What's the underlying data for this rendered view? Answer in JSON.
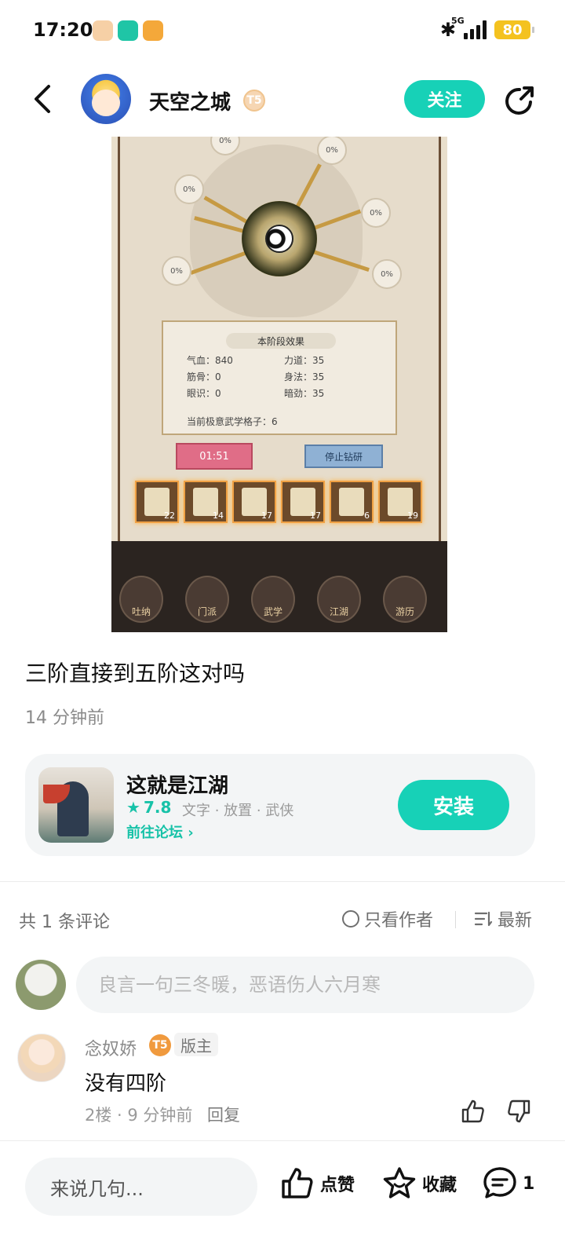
{
  "status_bar": {
    "time": "17:20",
    "network": "5G",
    "battery": "80",
    "bluetooth_icon": "bluetooth-icon"
  },
  "header": {
    "author_name": "天空之城",
    "author_level": "T5",
    "follow_label": "关注"
  },
  "post_image": {
    "nodes": [
      "0%",
      "0%",
      "0%",
      "0%",
      "0%",
      "0%"
    ],
    "panel_title": "本阶段效果",
    "stats": [
      {
        "label": "气血：840"
      },
      {
        "label": "力道：35"
      },
      {
        "label": "筋骨：0"
      },
      {
        "label": "身法：35"
      },
      {
        "label": "眼识：0"
      },
      {
        "label": "暗劲：35"
      }
    ],
    "current_slots": "当前极意武学格子：6",
    "timer": "01:51",
    "stop_label": "停止钻研",
    "slot_counts": [
      "22",
      "14",
      "17",
      "17",
      "6",
      "19"
    ],
    "tabs": [
      "吐纳",
      "门派",
      "武学",
      "江湖",
      "游历"
    ]
  },
  "post": {
    "title": "三阶直接到五阶这对吗",
    "time": "14 分钟前"
  },
  "game_card": {
    "name": "这就是江湖",
    "rating": "7.8",
    "tags": "文字 · 放置 · 武侠",
    "forum_link": "前往论坛",
    "install_label": "安装"
  },
  "comments_header": {
    "count": "共 1 条评论",
    "only_author": "只看作者",
    "sort": "最新"
  },
  "comment_input": {
    "placeholder": "良言一句三冬暖，恶语伤人六月寒"
  },
  "comments": [
    {
      "author": "念奴娇",
      "level": "T5",
      "role": "版主",
      "content": "没有四阶",
      "meta": "2楼 · 9 分钟前",
      "reply": "回复"
    }
  ],
  "bottom_bar": {
    "input_placeholder": "来说几句...",
    "like_label": "点赞",
    "fav_label": "收藏",
    "comment_count": "1"
  },
  "colors": {
    "accent": "#17d1b7",
    "accent_text": "#17c2a8"
  }
}
